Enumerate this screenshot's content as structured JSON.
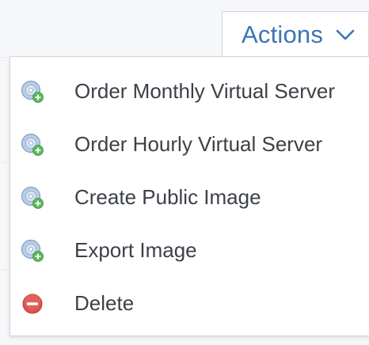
{
  "actions_button": {
    "label": "Actions",
    "icon": "chevron-down-icon",
    "accent_color": "#3b73b9"
  },
  "menu": {
    "items": [
      {
        "label": "Order Monthly Virtual Server",
        "icon": "disc-add-icon"
      },
      {
        "label": "Order Hourly Virtual Server",
        "icon": "disc-add-icon"
      },
      {
        "label": "Create Public Image",
        "icon": "disc-add-icon"
      },
      {
        "label": "Export Image",
        "icon": "disc-add-icon"
      },
      {
        "label": "Delete",
        "icon": "delete-icon"
      }
    ],
    "text_color": "#3c4148",
    "delete_color": "#d9534f",
    "add_badge_color": "#5cb85c"
  }
}
